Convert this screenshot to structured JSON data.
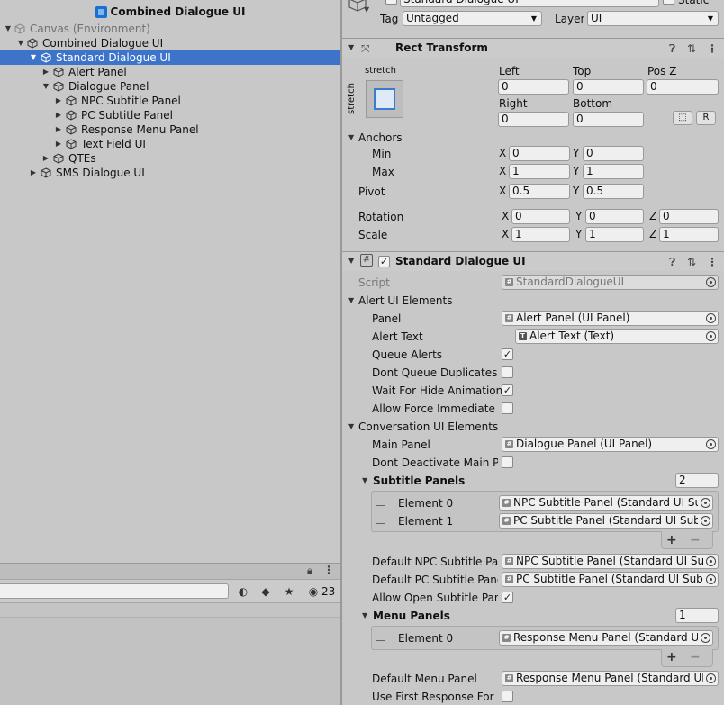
{
  "hierarchy": {
    "title": "Combined Dialogue UI",
    "nodes": [
      {
        "label": "Canvas (Environment)"
      },
      {
        "label": "Combined Dialogue UI"
      },
      {
        "label": "Standard Dialogue UI"
      },
      {
        "label": "Alert Panel"
      },
      {
        "label": "Dialogue Panel"
      },
      {
        "label": "NPC Subtitle Panel"
      },
      {
        "label": "PC Subtitle Panel"
      },
      {
        "label": "Response Menu Panel"
      },
      {
        "label": "Text Field UI"
      },
      {
        "label": "QTEs"
      },
      {
        "label": "SMS Dialogue UI"
      }
    ]
  },
  "project": {
    "hidden_count": "23"
  },
  "inspector": {
    "object": {
      "name": "Standard Dialogue UI",
      "static_label": "Static",
      "tag_label": "Tag",
      "tag_value": "Untagged",
      "layer_label": "Layer",
      "layer_value": "UI"
    },
    "rect_transform": {
      "title": "Rect Transform",
      "stretch_top": "stretch",
      "stretch_side": "stretch",
      "left_label": "Left",
      "left": "0",
      "top_label": "Top",
      "top": "0",
      "posz_label": "Pos Z",
      "posz": "0",
      "right_label": "Right",
      "right": "0",
      "bottom_label": "Bottom",
      "bottom": "0",
      "r_button": "R",
      "anchors_label": "Anchors",
      "min_label": "Min",
      "min_x": "0",
      "min_y": "0",
      "max_label": "Max",
      "max_x": "1",
      "max_y": "1",
      "pivot_label": "Pivot",
      "pivot_x": "0.5",
      "pivot_y": "0.5",
      "rotation_label": "Rotation",
      "rot_x": "0",
      "rot_y": "0",
      "rot_z": "0",
      "scale_label": "Scale",
      "scale_x": "1",
      "scale_y": "1",
      "scale_z": "1",
      "x": "X",
      "y": "Y",
      "z": "Z"
    },
    "standard_dialogue_ui": {
      "title": "Standard Dialogue UI",
      "script_label": "Script",
      "script_value": "StandardDialogueUI",
      "alert_section": "Alert UI Elements",
      "panel_label": "Panel",
      "panel_value": "Alert Panel (UI Panel)",
      "alert_text_label": "Alert Text",
      "alert_text_value": "Alert Text (Text)",
      "queue_alerts_label": "Queue Alerts",
      "dont_queue_dup_label": "Dont Queue Duplicates",
      "wait_hide_label": "Wait For Hide Animation",
      "allow_force_label": "Allow Force Immediate",
      "conv_section": "Conversation UI Elements",
      "main_panel_label": "Main Panel",
      "main_panel_value": "Dialogue Panel (UI Panel)",
      "dont_deactivate_label": "Dont Deactivate Main Pa",
      "subtitle_panels_label": "Subtitle Panels",
      "subtitle_panels_count": "2",
      "sub_elem0_label": "Element 0",
      "sub_elem0_value": "NPC Subtitle Panel (Standard UI Sub",
      "sub_elem1_label": "Element 1",
      "sub_elem1_value": "PC Subtitle Panel (Standard UI Subti",
      "default_npc_label": "Default NPC Subtitle Pan",
      "default_npc_value": "NPC Subtitle Panel (Standard UI Sub",
      "default_pc_label": "Default PC Subtitle Panel",
      "default_pc_value": "PC Subtitle Panel (Standard UI Subtit",
      "allow_open_label": "Allow Open Subtitle Pane",
      "menu_panels_label": "Menu Panels",
      "menu_panels_count": "1",
      "menu_elem0_label": "Element 0",
      "menu_elem0_value": "Response Menu Panel (Standard UI I",
      "default_menu_label": "Default Menu Panel",
      "default_menu_value": "Response Menu Panel (Standard UI M",
      "use_first_label": "Use First Response For M"
    }
  }
}
